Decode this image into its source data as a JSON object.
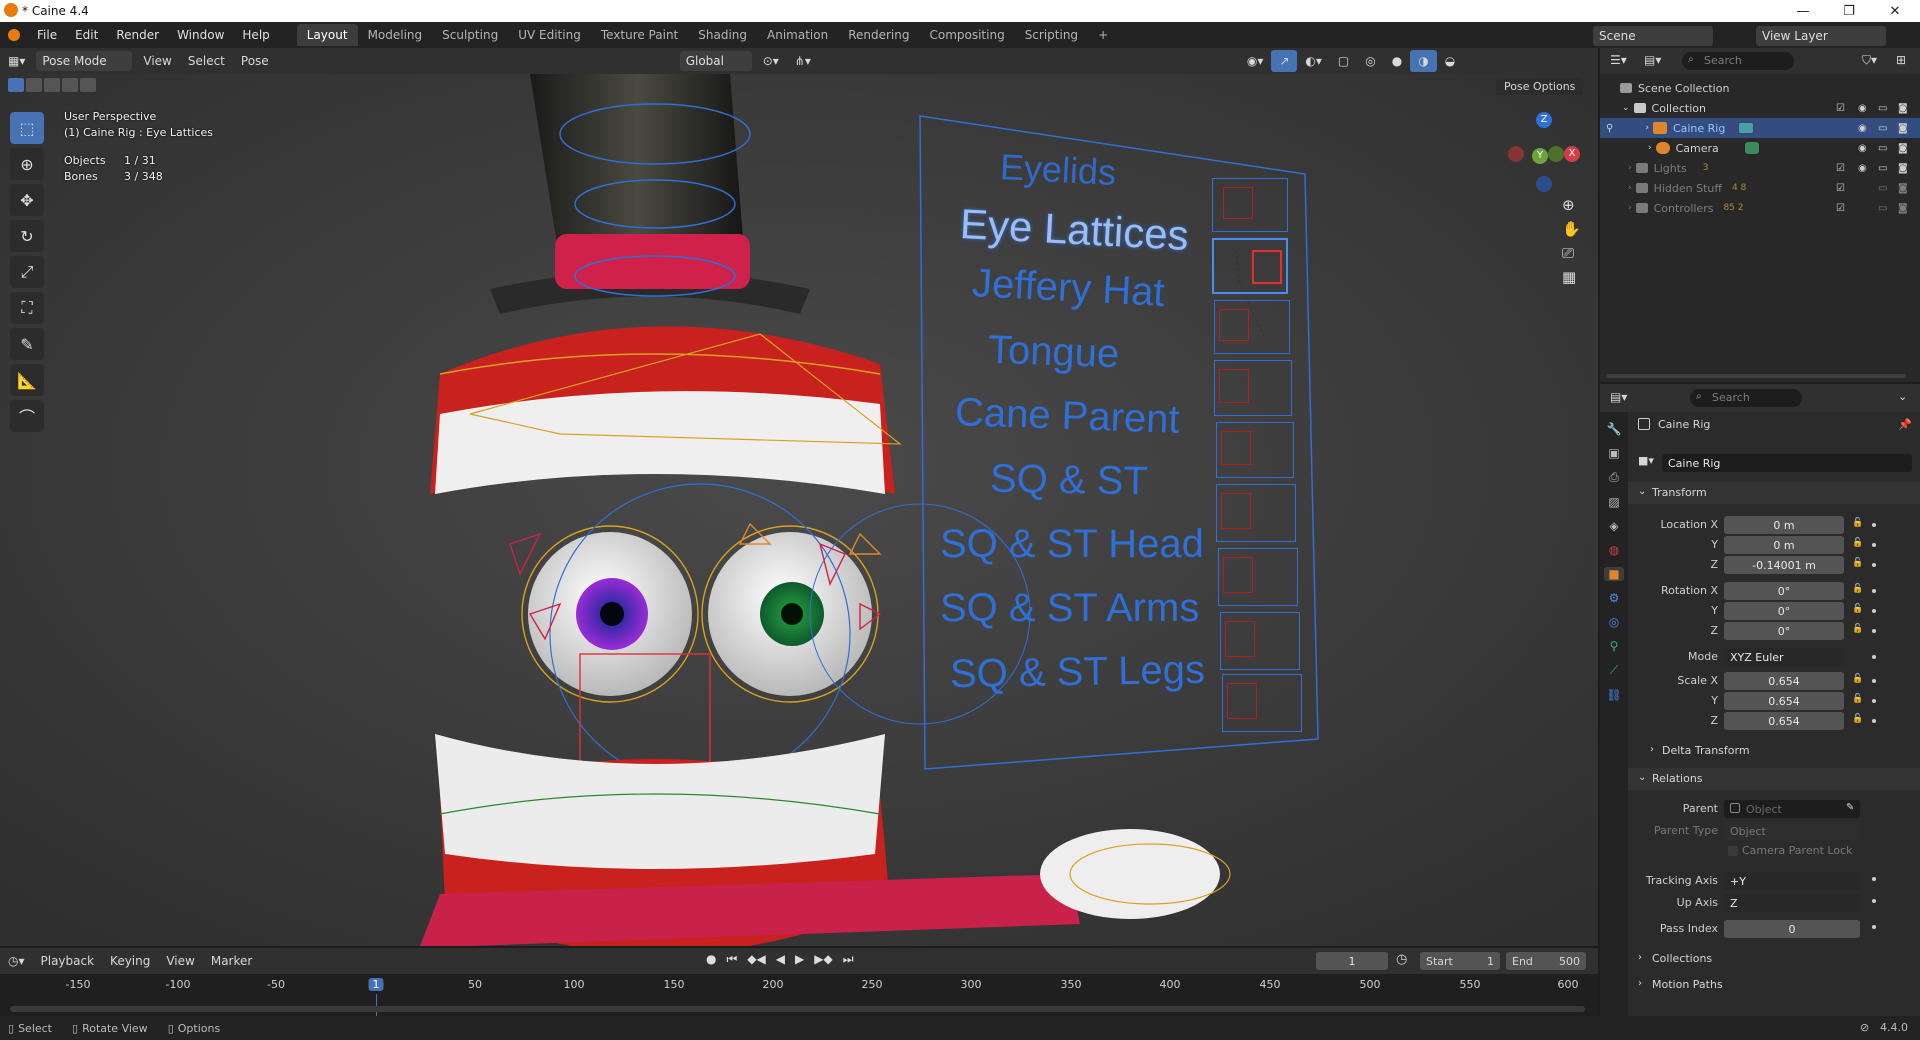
{
  "window": {
    "title": "* Caine 4.4",
    "minimize": "—",
    "maximize": "❐",
    "close": "✕"
  },
  "menu": [
    "File",
    "Edit",
    "Render",
    "Window",
    "Help"
  ],
  "workspaces": [
    "Layout",
    "Modeling",
    "Sculpting",
    "UV Editing",
    "Texture Paint",
    "Shading",
    "Animation",
    "Rendering",
    "Compositing",
    "Scripting"
  ],
  "workspace_add": "+",
  "scene": {
    "label": "Scene",
    "view_layer": "View Layer"
  },
  "viewport_header": {
    "mode": "Pose Mode",
    "view": "View",
    "select": "Select",
    "pose": "Pose",
    "orientation": "Global",
    "pose_options": "Pose Options"
  },
  "viewport_info": {
    "perspective": "User Perspective",
    "active": "(1) Caine Rig : Eye Lattices",
    "objects_label": "Objects",
    "objects_value": "1 / 31",
    "bones_label": "Bones",
    "bones_value": "3 / 348"
  },
  "gizmo": {
    "x": "X",
    "y": "Y",
    "z": "Z"
  },
  "controller_board": {
    "labels": [
      "Eyelids",
      "Eye Lattices",
      "Jeffery Hat",
      "Tongue",
      "Cane Parent",
      "SQ & ST",
      "SQ & ST Head",
      "SQ & ST Arms",
      "SQ & ST Legs"
    ]
  },
  "outliner": {
    "search_placeholder": "Search",
    "scene_collection": "Scene Collection",
    "rows": [
      {
        "label": "Collection",
        "state": "normal"
      },
      {
        "label": "Caine Rig",
        "state": "selected"
      },
      {
        "label": "Camera",
        "state": "normal"
      },
      {
        "label": "Lights",
        "state": "dim",
        "count": "3"
      },
      {
        "label": "Hidden Stuff",
        "state": "dim",
        "count": "4 8"
      },
      {
        "label": "Controllers",
        "state": "dim",
        "count": "85 2"
      }
    ]
  },
  "properties": {
    "search_placeholder": "Search",
    "object_name": "Caine Rig",
    "datablock": "Caine Rig",
    "transform": {
      "title": "Transform",
      "location_label": "Location X",
      "loc_x": "0 m",
      "loc_y": "0 m",
      "loc_z": "-0.14001 m",
      "rotation_label": "Rotation X",
      "rot_x": "0°",
      "rot_y": "0°",
      "rot_z": "0°",
      "mode_label": "Mode",
      "mode": "XYZ Euler",
      "scale_label": "Scale X",
      "scale_x": "0.654",
      "scale_y": "0.654",
      "scale_z": "0.654",
      "y": "Y",
      "z": "Z"
    },
    "delta_transform": "Delta Transform",
    "relations": {
      "title": "Relations",
      "parent_label": "Parent",
      "parent_placeholder": "Object",
      "parent_type_label": "Parent Type",
      "parent_type": "Object",
      "camera_parent_lock": "Camera Parent Lock",
      "tracking_axis_label": "Tracking Axis",
      "tracking_axis": "+Y",
      "up_axis_label": "Up Axis",
      "up_axis": "Z",
      "pass_index_label": "Pass Index",
      "pass_index": "0"
    },
    "collections": "Collections",
    "motion_paths": "Motion Paths"
  },
  "timeline": {
    "playback": "Playback",
    "keying": "Keying",
    "view": "View",
    "marker": "Marker",
    "current_frame": "1",
    "start_label": "Start",
    "start": "1",
    "end_label": "End",
    "end": "500",
    "ticks": [
      "-150",
      "-100",
      "-50",
      "1",
      "50",
      "100",
      "150",
      "200",
      "250",
      "300",
      "350",
      "400",
      "450",
      "500",
      "550",
      "600"
    ]
  },
  "status": {
    "select": "Select",
    "rotate_view": "Rotate View",
    "options": "Options",
    "version": "4.4.0"
  },
  "colors": {
    "accent": "#4772b3",
    "selected_row": "#334d80",
    "board_lines": "#2f6fd6",
    "active_box": "#d33"
  }
}
